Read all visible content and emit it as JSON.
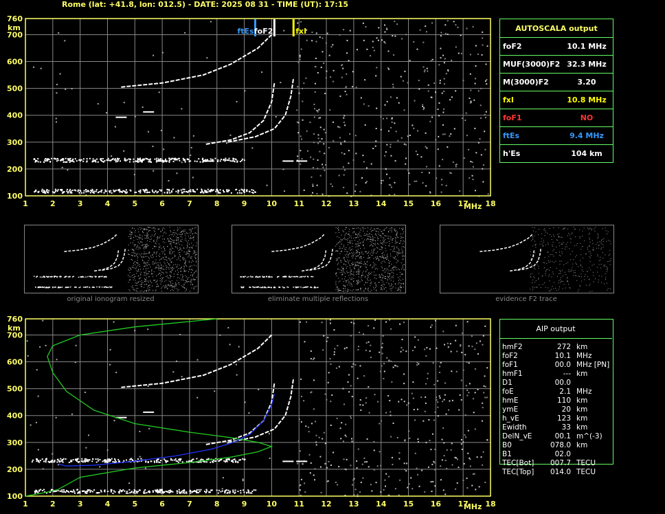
{
  "header": {
    "title": "Rome (lat: +41.8, lon: 012.5) - DATE: 2025 08 31 - TIME (UT): 17:15"
  },
  "colors": {
    "axis": "#ffff66",
    "grid": "#888888",
    "echo": "#ffffff",
    "green": "#66ff66",
    "blue_es": "#3399ff",
    "yellow_fxi": "#ffff00",
    "red": "#ff3333",
    "profile_green": "#22cc22",
    "profile_blue": "#2233ff"
  },
  "autoscala": {
    "title": "AUTOSCALA output",
    "rows": [
      {
        "label": "foF2",
        "value": "10.1 MHz",
        "color": "#ffffff"
      },
      {
        "label": "MUF(3000)F2",
        "value": "32.3 MHz",
        "color": "#ffffff"
      },
      {
        "label": "M(3000)F2",
        "value": "3.20",
        "color": "#ffffff"
      },
      {
        "label": "fxI",
        "value": "10.8 MHz",
        "color": "#ffff00"
      },
      {
        "label": "foF1",
        "value": "NO",
        "color": "#ff3333"
      },
      {
        "label": "ftEs",
        "value": "9.4 MHz",
        "color": "#3399ff"
      },
      {
        "label": "h'Es",
        "value": "104    km",
        "color": "#ffffff"
      }
    ]
  },
  "aip": {
    "title": "AIP output",
    "rows": [
      [
        "hmF2",
        "272",
        "km"
      ],
      [
        "foF2",
        "10.1",
        "MHz"
      ],
      [
        "foF1",
        "00.0",
        "MHz   [PN]"
      ],
      [
        "hmF1",
        "---",
        "km"
      ],
      [
        "D1",
        "00.0",
        ""
      ],
      [
        "foE",
        "2.1",
        "MHz"
      ],
      [
        "hmE",
        "110",
        "km"
      ],
      [
        "ymE",
        "20",
        "km"
      ],
      [
        "h_vE",
        "123",
        "km"
      ],
      [
        "Ewidth",
        "33",
        "km"
      ],
      [
        "DelN_vE",
        "00.1",
        "m^(-3)"
      ],
      [
        "B0",
        "078.0",
        "km"
      ],
      [
        "B1",
        "02.0",
        ""
      ],
      [
        "TEC[Bot]",
        "007.7",
        "TECU"
      ],
      [
        "TEC[Top]",
        "014.0",
        "TECU"
      ]
    ]
  },
  "thumb_captions": [
    "original ionogram resized",
    "eliminate multiple reflections",
    "evidence F2 trace"
  ],
  "markers": {
    "ftes": "ftEs",
    "fof2": "foF2",
    "fxi": "fxI"
  },
  "chart_data": [
    {
      "type": "scatter",
      "title": "",
      "xlabel": "MHz",
      "ylabel": "km",
      "xlim": [
        1,
        18
      ],
      "ylim": [
        100,
        760
      ],
      "xticks": [
        "1",
        "2",
        "3",
        "4",
        "5",
        "6",
        "7",
        "8",
        "9",
        "10",
        "11",
        "12",
        "13",
        "14",
        "15",
        "16",
        "17",
        "18"
      ],
      "yticks": [
        "100",
        "200",
        "300",
        "400",
        "500",
        "600",
        "700",
        "760"
      ],
      "grid": true,
      "vertical_markers": [
        {
          "label": "ftEs",
          "x": 9.4,
          "color": "#3399ff"
        },
        {
          "label": "foF2",
          "x": 10.1,
          "color": "#ffffff"
        },
        {
          "label": "fxI",
          "x": 10.8,
          "color": "#ffff00"
        }
      ],
      "traces": [
        {
          "name": "Es",
          "x": [
            1.3,
            9.4
          ],
          "y": [
            120,
            120
          ]
        },
        {
          "name": "Es multiple",
          "x": [
            1.2,
            9.0
          ],
          "y": [
            235,
            235
          ]
        },
        {
          "name": "F2 ordinary",
          "x": [
            7.6,
            8.5,
            9.2,
            9.7,
            10.0,
            10.1
          ],
          "y": [
            292,
            308,
            335,
            380,
            450,
            520
          ]
        },
        {
          "name": "F2 extraordinary",
          "x": [
            8.4,
            9.4,
            10.1,
            10.5,
            10.7,
            10.8
          ],
          "y": [
            300,
            320,
            350,
            400,
            470,
            540
          ]
        },
        {
          "name": "F2 multiple",
          "x": [
            4.5,
            6.0,
            7.5,
            8.5,
            9.5,
            10.0
          ],
          "y": [
            505,
            520,
            550,
            590,
            650,
            700
          ]
        }
      ]
    },
    {
      "type": "line",
      "title": "",
      "xlabel": "MHz",
      "ylabel": "km",
      "xlim": [
        1,
        18
      ],
      "ylim": [
        100,
        760
      ],
      "grid": true,
      "series": [
        {
          "color": "#22cc22",
          "x": [
            1.0,
            1.8,
            2.2,
            3.0,
            5.0,
            7.0,
            8.5,
            9.5,
            10.0,
            9.5,
            8.5,
            7.0,
            5.0,
            3.5,
            2.5,
            2.0,
            1.8,
            2.0,
            3.0,
            5.0,
            7.0,
            8.0
          ],
          "y": [
            100,
            115,
            125,
            170,
            205,
            225,
            245,
            265,
            285,
            300,
            318,
            338,
            370,
            420,
            490,
            560,
            620,
            660,
            700,
            730,
            750,
            760
          ]
        },
        {
          "color": "#2233ff",
          "x": [
            2.2,
            2.5,
            3.5,
            5.0,
            6.5,
            7.8,
            8.6,
            9.2,
            9.7,
            10.0,
            10.1
          ],
          "y": [
            220,
            212,
            215,
            230,
            250,
            275,
            300,
            330,
            380,
            440,
            480
          ]
        }
      ]
    }
  ]
}
